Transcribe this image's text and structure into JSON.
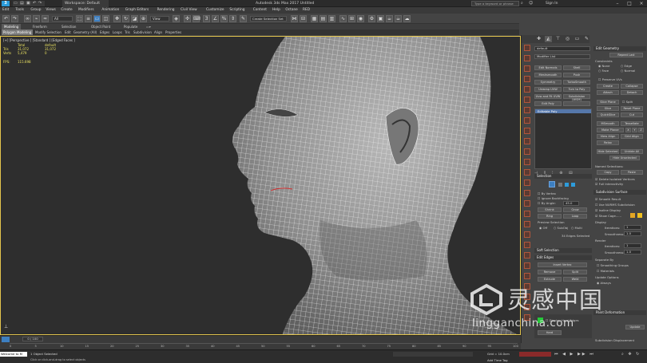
{
  "title_bar": {
    "logo": "3",
    "workspace": "Workspace: Default",
    "app_title": "Autodesk 3ds Max 2017     Untitled",
    "search_placeholder": "Type a keyword or phrase",
    "sign_in": "Sign In"
  },
  "menu": [
    "Edit",
    "Tools",
    "Group",
    "Views",
    "Create",
    "Modifiers",
    "Animation",
    "Graph Editors",
    "Rendering",
    "Civil View",
    "Customize",
    "Scripting",
    "Content",
    "Help",
    "Octane",
    "RED"
  ],
  "toolbar": {
    "filter_value": "All",
    "view_value": "View",
    "selection_set": "Create Selection Set"
  },
  "ribbon": {
    "tabs": [
      "Modeling",
      "Freeform",
      "Selection",
      "Object Paint",
      "Populate"
    ],
    "active_tab": "Modeling",
    "sub": [
      "Polygon Modeling",
      "Modify Selection",
      "Edit",
      "Geometry (All)",
      "Edges",
      "Loops",
      "Tris",
      "Subdivision",
      "Align",
      "Properties"
    ]
  },
  "viewport": {
    "label": "[+] [Perspective ] [Standard ] [Edged Faces ]",
    "stats": {
      "header_total": "Total",
      "header_object": "default",
      "polys_label": "Tris",
      "polys_total": "31,072",
      "polys_obj": "31,072",
      "verts_label": "Verts",
      "verts_total": "5,479",
      "verts_obj": "0",
      "fps_label": "FPS:",
      "fps_value": "115.698"
    }
  },
  "command_panel": {
    "object_name": "default",
    "modifier_list": "Modifier List",
    "buttons_left": [
      "Edit Normals",
      "Shell",
      "Meshsmooth",
      "Push",
      "Symmetry",
      "TurboSmooth",
      "Unwrap UVW",
      "Turn to Poly",
      "Uvw and Fit UVW",
      "Subdivision (WSM)",
      "Edit Poly",
      ""
    ],
    "stack_item": "Editable Poly",
    "selection_title": "Selection",
    "by_vertex": "By Vertex",
    "ignore_backfacing": "Ignore Backfacing",
    "by_angle": "By Angle:",
    "angle_value": "45.0",
    "shrink": "Shrink",
    "grow": "Grow",
    "ring": "Ring",
    "loop": "Loop",
    "preview_selection": "Preview Selection",
    "preview_off": "Off",
    "preview_subobj": "SubObj",
    "preview_multi": "Multi",
    "edges_selected": "34 Edges Selected",
    "soft_selection": "Soft Selection",
    "edit_edges": "Edit Edges",
    "insert_vertex": "Insert Vertex",
    "remove": "Remove",
    "split": "Split",
    "extrude": "Extrude",
    "weld": "Weld",
    "edit_geometry_title": "Edit Geometry",
    "repeat_last": "Repeat Last",
    "constraints": "Constraints",
    "c_none": "None",
    "c_edge": "Edge",
    "c_face": "Face",
    "c_normal": "Normal",
    "preserve_uvs": "Preserve UVs",
    "create": "Create",
    "collapse": "Collapse",
    "attach": "Attach",
    "detach": "Detach",
    "slice_plane": "Slice Plane",
    "split_chk": "Split",
    "slice": "Slice",
    "reset_plane": "Reset Plane",
    "quickslice": "QuickSlice",
    "cut": "Cut",
    "msmooth": "MSmooth",
    "tessellate": "Tessellate",
    "make_planar": "Make Planar",
    "x": "X",
    "y": "Y",
    "z": "Z",
    "view_align": "View Align",
    "grid_align": "Grid Align",
    "relax": "Relax",
    "hide_selected": "Hide Selected",
    "unhide_all": "Unhide All",
    "hide_unselected": "Hide Unselected",
    "named_selections": "Named Selections:",
    "copy": "Copy",
    "paste": "Paste",
    "delete_isolated": "Delete Isolated Vertices",
    "full_interactivity": "Full Interactivity",
    "subdivision_surface": "Subdivision Surface",
    "smooth_result": "Smooth Result",
    "use_nurms": "Use NURMS Subdivision",
    "isoline_display": "Isoline Display",
    "show_cage": "Show Cage......",
    "display": "Display",
    "iterations_label": "Iterations:",
    "iterations_value": "1",
    "smoothness_label": "Smoothness:",
    "smoothness_value": "1.0",
    "render": "Render",
    "separate_by": "Separate By",
    "smoothing_groups": "Smoothing Groups",
    "materials": "Materials",
    "update_options": "Update Options",
    "always": "Always",
    "paint_deformation": "Paint Deformation",
    "display_hard_edges": "Display Hard Edges",
    "hard": "Hard",
    "update": "Update",
    "subdivision_displacement": "Subdivision Displacement"
  },
  "timeline": {
    "frame": "0 / 100",
    "ticks": [
      "0",
      "5",
      "10",
      "15",
      "20",
      "25",
      "30",
      "35",
      "40",
      "45",
      "50",
      "55",
      "60",
      "65",
      "70",
      "75",
      "80",
      "85",
      "90",
      "95",
      "100"
    ]
  },
  "status": {
    "maxscript": "Welcome to M",
    "selected": "1 Object Selected",
    "hint": "Click or click-and-drag to select objects",
    "grid": "Grid = 10.0cm",
    "add_time_tag": "Add Time Tag"
  },
  "watermark": {
    "cn": "灵感中国",
    "url": "lingganchina.com"
  },
  "colors": {
    "viewport_border": "#e3c54d",
    "accent_blue": "#2d9cdb",
    "selected_edge": "#d43030",
    "cage_a": "#e3a624",
    "cage_b": "#f0c020",
    "hard_edge_swatch": "#26c93a"
  }
}
